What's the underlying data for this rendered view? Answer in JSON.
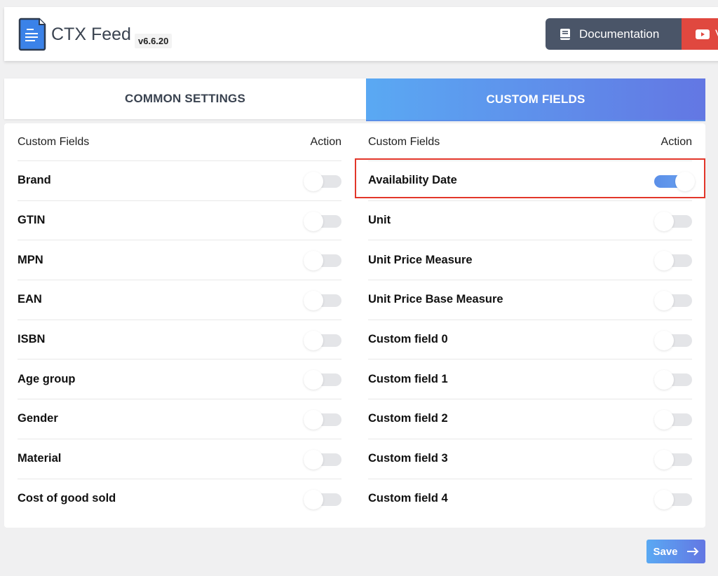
{
  "header": {
    "app_title": "CTX Feed",
    "version": "v6.6.20",
    "documentation_label": "Documentation",
    "video_label": "V"
  },
  "tabs": [
    {
      "label": "COMMON SETTINGS",
      "active": false
    },
    {
      "label": "CUSTOM FIELDS",
      "active": true
    }
  ],
  "left_column": {
    "header_field": "Custom Fields",
    "header_action": "Action",
    "rows": [
      {
        "label": "Brand",
        "enabled": false
      },
      {
        "label": "GTIN",
        "enabled": false
      },
      {
        "label": "MPN",
        "enabled": false
      },
      {
        "label": "EAN",
        "enabled": false
      },
      {
        "label": "ISBN",
        "enabled": false
      },
      {
        "label": "Age group",
        "enabled": false
      },
      {
        "label": "Gender",
        "enabled": false
      },
      {
        "label": "Material",
        "enabled": false
      },
      {
        "label": "Cost of good sold",
        "enabled": false
      }
    ]
  },
  "right_column": {
    "header_field": "Custom Fields",
    "header_action": "Action",
    "rows": [
      {
        "label": "Availability Date",
        "enabled": true
      },
      {
        "label": "Unit",
        "enabled": false
      },
      {
        "label": "Unit Price Measure",
        "enabled": false
      },
      {
        "label": "Unit Price Base Measure",
        "enabled": false
      },
      {
        "label": "Custom field 0",
        "enabled": false
      },
      {
        "label": "Custom field 1",
        "enabled": false
      },
      {
        "label": "Custom field 2",
        "enabled": false
      },
      {
        "label": "Custom field 3",
        "enabled": false
      },
      {
        "label": "Custom field 4",
        "enabled": false
      }
    ]
  },
  "save": {
    "label": "Save",
    "icon": "arrow-right-icon"
  },
  "colors": {
    "accent_start": "#5aa9f3",
    "accent_end": "#6377e3",
    "doc_button": "#4a5568",
    "video_button": "#e0483f",
    "highlight": "#e2362a"
  }
}
